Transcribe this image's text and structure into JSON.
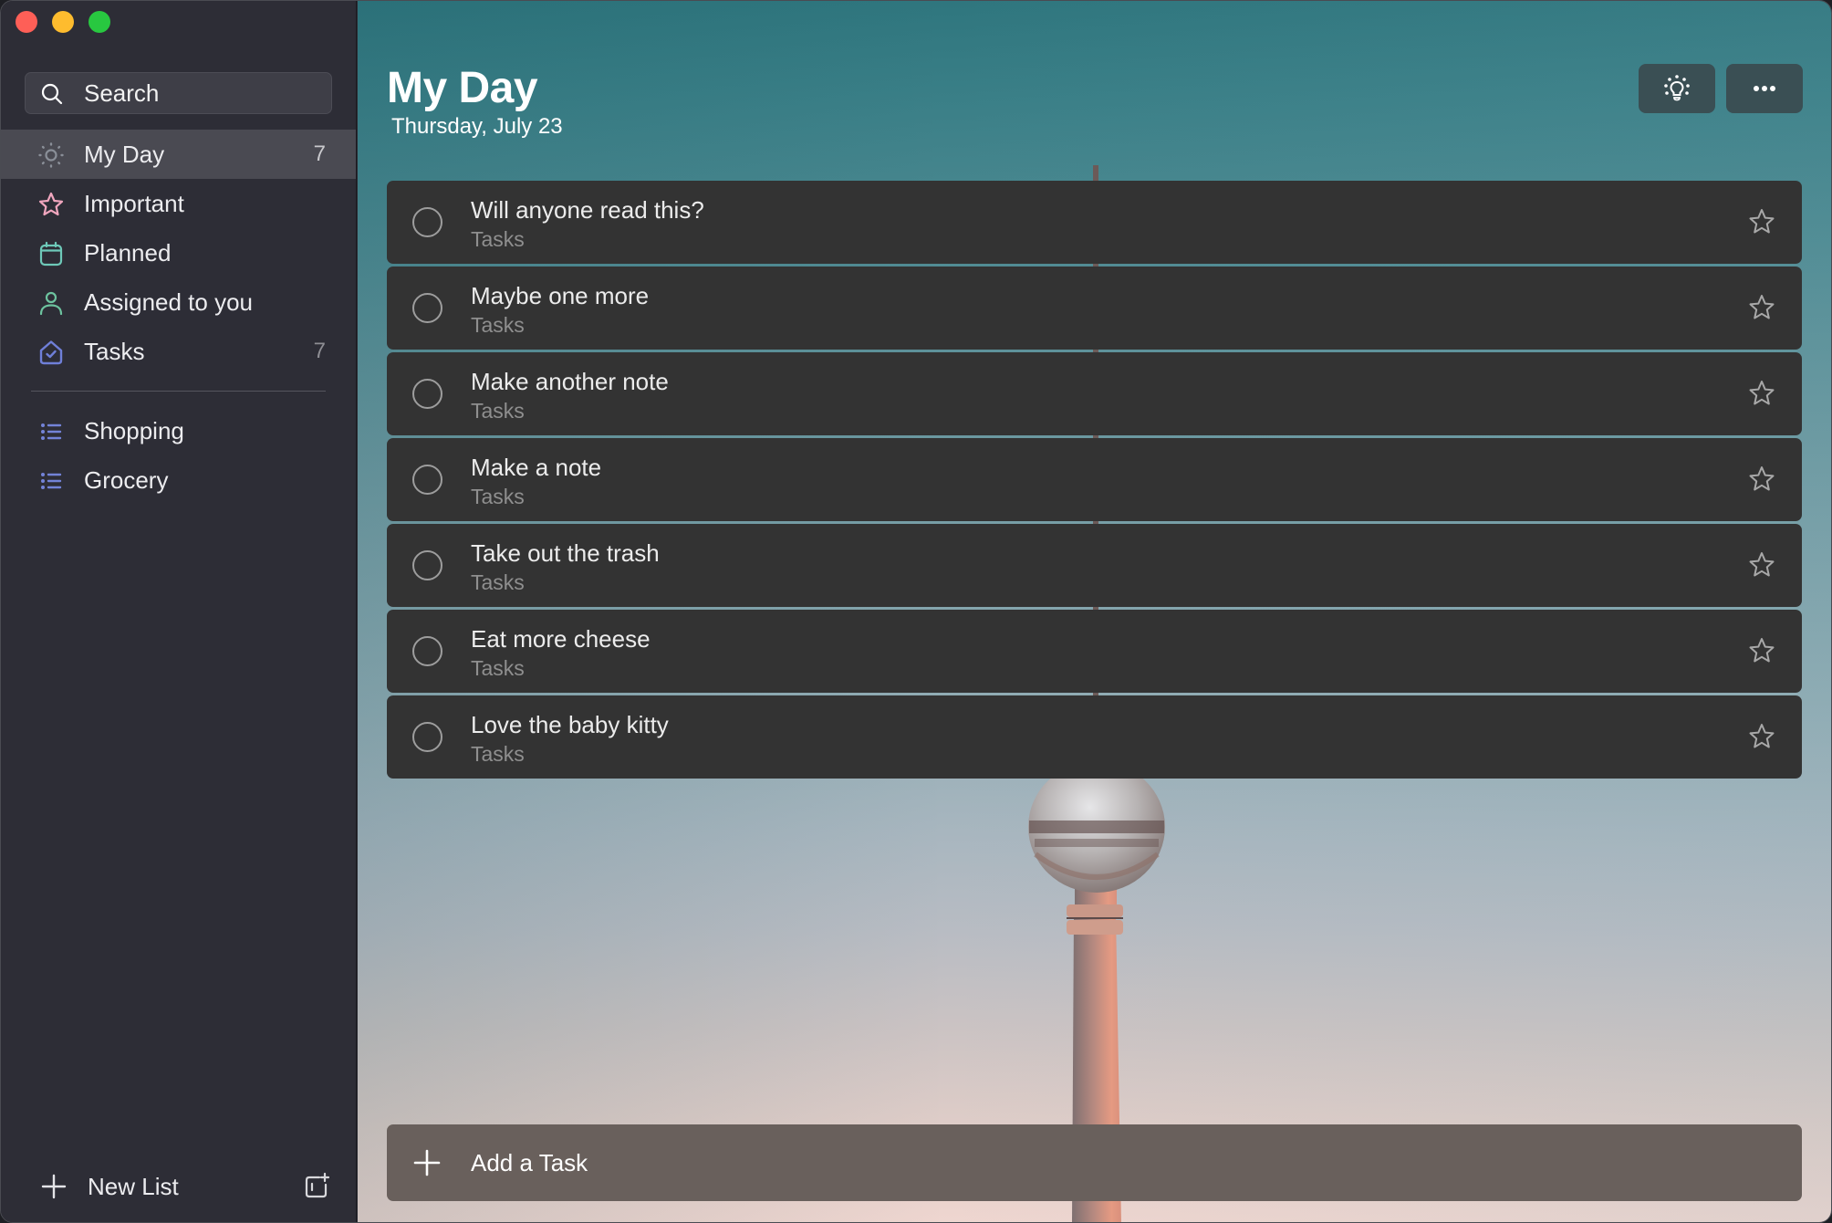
{
  "window": {
    "controls": [
      "close",
      "minimize",
      "maximize"
    ]
  },
  "sidebar": {
    "search": {
      "placeholder": "Search",
      "value": "",
      "icon": "search-icon"
    },
    "smart_lists": [
      {
        "label": "My Day",
        "count": "7",
        "icon": "sun-icon",
        "icon_color": "#8a8f98",
        "selected": true
      },
      {
        "label": "Important",
        "count": "",
        "icon": "star-icon",
        "icon_color": "#f0a6be",
        "selected": false
      },
      {
        "label": "Planned",
        "count": "",
        "icon": "calendar-icon",
        "icon_color": "#6ec9b9",
        "selected": false
      },
      {
        "label": "Assigned to you",
        "count": "",
        "icon": "person-icon",
        "icon_color": "#6dc39f",
        "selected": false
      },
      {
        "label": "Tasks",
        "count": "7",
        "icon": "home-check-icon",
        "icon_color": "#6f7fd8",
        "selected": false
      }
    ],
    "user_lists": [
      {
        "label": "Shopping",
        "icon": "list-icon",
        "icon_color": "#7383d8"
      },
      {
        "label": "Grocery",
        "icon": "list-icon",
        "icon_color": "#7383d8"
      }
    ],
    "new_list_label": "New List",
    "new_group_icon": "new-group-icon"
  },
  "main": {
    "title": "My Day",
    "date": "Thursday, July 23",
    "buttons": {
      "suggestions_icon": "lightbulb-icon",
      "more_icon": "more-icon"
    },
    "tasks": [
      {
        "title": "Will anyone read this?",
        "list": "Tasks",
        "completed": false,
        "important": false
      },
      {
        "title": "Maybe one more",
        "list": "Tasks",
        "completed": false,
        "important": false
      },
      {
        "title": "Make another note",
        "list": "Tasks",
        "completed": false,
        "important": false
      },
      {
        "title": "Make a note",
        "list": "Tasks",
        "completed": false,
        "important": false
      },
      {
        "title": "Take out the trash",
        "list": "Tasks",
        "completed": false,
        "important": false
      },
      {
        "title": "Eat more cheese",
        "list": "Tasks",
        "completed": false,
        "important": false
      },
      {
        "title": "Love the baby kitty",
        "list": "Tasks",
        "completed": false,
        "important": false
      }
    ],
    "add_task": {
      "placeholder": "Add a Task",
      "value": ""
    }
  },
  "colors": {
    "sidebar_bg": "#2d2d36",
    "selected_row": "#4a4a52",
    "card_bg": "#333333",
    "add_task_bg": "#69605c",
    "header_button_bg": "#3a4f54"
  }
}
